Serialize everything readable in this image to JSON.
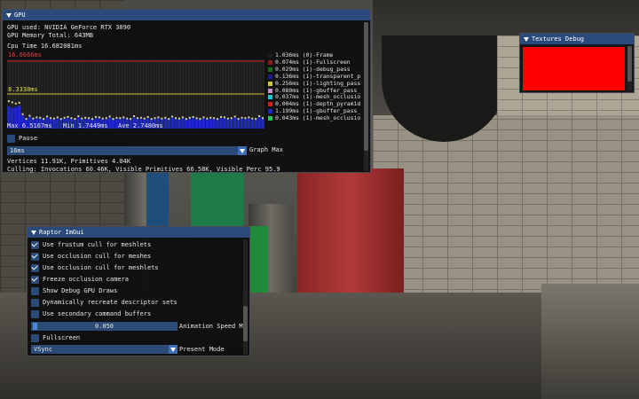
{
  "gpu_window": {
    "title": "GPU",
    "gpu_used": "GPU used: NVIDIA GeForce RTX 3090",
    "gpu_memory": "GPU Memory Total: 643MB",
    "cpu_time": "Cpu Time 16.682081ms",
    "graph_max_label": "16.6666ms",
    "graph_mid_label": "8.3330ms",
    "stats": {
      "max": "Max 6.5167ms",
      "min": "Min 1.7449ms",
      "ave": "Ave 2.7480ms"
    },
    "pause_label": "Pause",
    "graph_max_select": {
      "value": "16ms",
      "label": "Graph Max"
    },
    "vertices": "Vertices 11.91K, Primitives 4.04K",
    "culling": "Culling: Invocations 60.46K, Visible Primitives 66.58K, Visible Perc 95.9",
    "legend": [
      {
        "text": "1.036ms (0)-Frame",
        "color": "#1a1a1a"
      },
      {
        "text": "0.074ms (1)-Fullscreen",
        "color": "#8a1a1a"
      },
      {
        "text": "0.029ms (1)-debug_pass",
        "color": "#1a6e1a"
      },
      {
        "text": "0.136ms (1)-transparent_p",
        "color": "#1a1a8a"
      },
      {
        "text": "0.256ms (1)-lighting_pass",
        "color": "#c8c83a"
      },
      {
        "text": "0.080ms (1)-gbuffer_pass_",
        "color": "#c890c8"
      },
      {
        "text": "0.037ms (1)-mesh_occlusio",
        "color": "#19c8d2"
      },
      {
        "text": "0.004ms (1)-depth_pyramid",
        "color": "#d21e1e"
      },
      {
        "text": "1.199ms (1)-gbuffer_pass_",
        "color": "#1e28c8"
      },
      {
        "text": "0.043ms (1)-mesh_occlusio",
        "color": "#1ec85a"
      }
    ],
    "graph_colors": {
      "max_line": "#c81e1e",
      "mid_line": "#c8c832",
      "bar": "#1e28c8"
    }
  },
  "chart_data": {
    "type": "bar",
    "title": "",
    "xlabel": "",
    "ylabel": "",
    "ylim": [
      0,
      16.6666
    ],
    "series": [
      {
        "name": "",
        "values": [
          6.5,
          6.2,
          5.9,
          6.1,
          3.2,
          2.0,
          2.8,
          2.1,
          2.4,
          2.3,
          2.0,
          2.6,
          2.2,
          2.1,
          2.4,
          2.0,
          2.3,
          2.5,
          2.2,
          2.0,
          2.7,
          2.1,
          2.3,
          2.2,
          2.0,
          2.5,
          2.4,
          2.1,
          2.2,
          2.6,
          2.0,
          2.3,
          2.2,
          2.4,
          2.1,
          2.0,
          2.7,
          2.2,
          2.3,
          2.1,
          2.5,
          2.0,
          2.2,
          2.4,
          2.1,
          2.3,
          2.0,
          2.6,
          2.2,
          2.1,
          2.4,
          2.0,
          2.3,
          2.5,
          2.2,
          2.0,
          2.4,
          2.1,
          2.3,
          2.2,
          2.0,
          2.5,
          2.4,
          2.1,
          2.2,
          2.6,
          2.0,
          2.3,
          2.2,
          2.4,
          2.1,
          2.0,
          2.7,
          2.2
        ]
      },
      {
        "name": "",
        "values": [
          5.2,
          4.8,
          5.0,
          5.4,
          2.9,
          1.9,
          2.6,
          1.9,
          2.2,
          2.1,
          1.9,
          2.4,
          2.0,
          1.9,
          2.2,
          1.9,
          2.1,
          2.3,
          2.0,
          1.9,
          2.5,
          1.9,
          2.1,
          2.0,
          1.9,
          2.3,
          2.2,
          1.9,
          2.0,
          2.4,
          1.9,
          2.1,
          2.0,
          2.2,
          1.9,
          1.9,
          2.5,
          2.0,
          2.1,
          1.9,
          2.3,
          1.9,
          2.0,
          2.2,
          1.9,
          2.1,
          1.9,
          2.4,
          2.0,
          1.9,
          2.2,
          1.9,
          2.1,
          2.3,
          2.0,
          1.9,
          2.2,
          1.9,
          2.1,
          2.0,
          1.9,
          2.3,
          2.2,
          1.9,
          2.0,
          2.4,
          1.9,
          2.1,
          2.0,
          2.2,
          1.9,
          1.9,
          2.5,
          2.0
        ]
      }
    ],
    "reference_lines": [
      16.6666,
      8.333
    ],
    "grid": true
  },
  "textures_window": {
    "title": "Textures Debug",
    "texture_color": "#ff0000"
  },
  "raptor_window": {
    "title": "Raptor ImGui",
    "options": [
      {
        "label": "Use frustum cull for meshlets",
        "checked": true
      },
      {
        "label": "Use occlusion cull for meshes",
        "checked": true
      },
      {
        "label": "Use occlusion cull for meshlets",
        "checked": true
      },
      {
        "label": "Freeze occlusion camera",
        "checked": true
      },
      {
        "label": "Show Debug GPU Draws",
        "checked": false
      },
      {
        "label": "Dynamically recreate descriptor sets",
        "checked": false
      },
      {
        "label": "Use secondary command buffers",
        "checked": false
      }
    ],
    "animation_speed": {
      "value": "0.050",
      "label": "Animation Speed Mu"
    },
    "fullscreen": {
      "label": "Fullscreen",
      "checked": false
    },
    "present_mode": {
      "value": "VSync",
      "label": "Present Mode"
    }
  }
}
